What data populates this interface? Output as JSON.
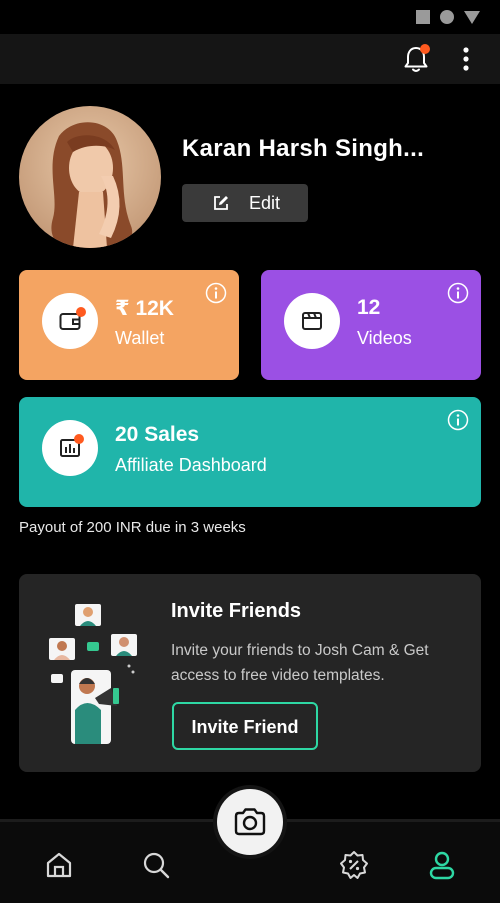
{
  "profile": {
    "name": "Karan Harsh Singh...",
    "edit_label": "Edit"
  },
  "cards": {
    "wallet": {
      "value": "₹ 12K",
      "label": "Wallet",
      "color": "#f4a462"
    },
    "videos": {
      "value": "12",
      "label": "Videos",
      "color": "#9b50e4"
    },
    "affiliate": {
      "value": "20 Sales",
      "label": "Affiliate Dashboard",
      "color": "#20b5aa"
    }
  },
  "payout_text": "Payout of 200 INR due in 3 weeks",
  "invite": {
    "title": "Invite Friends",
    "description": "Invite your friends to Josh Cam & Get access to free video templates.",
    "button_label": "Invite Friend",
    "accent": "#2ed8a4"
  },
  "icons": {
    "appbar": [
      "bell-icon",
      "more-vertical-icon"
    ],
    "nav": [
      "home-icon",
      "search-icon",
      "camera-icon",
      "badge-percent-icon",
      "profile-icon"
    ]
  },
  "colors": {
    "notification_dot": "#ff5a1f",
    "active_nav": "#2ed8a4"
  }
}
